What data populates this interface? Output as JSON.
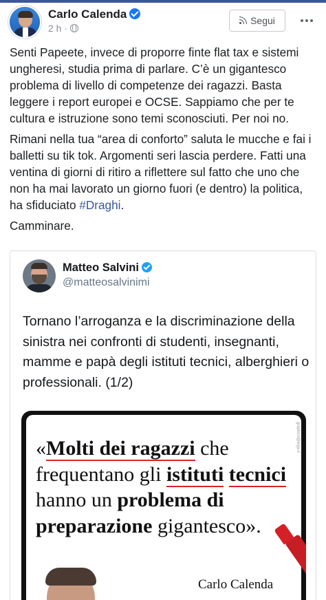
{
  "post": {
    "author_name": "Carlo Calenda",
    "time": "2 h ·",
    "follow_label": "Segui",
    "paragraph1": "Senti Papeete, invece di proporre finte flat tax e sistemi ungheresi, studia prima di parlare. C’è un gigantesco problema di livello di competenze dei ragazzi. Basta leggere i report europei e OCSE. Sappiamo che per te cultura e istruzione sono temi sconosciuti. Per noi no.",
    "paragraph2_before_tag": "Rimani nella tua “area di conforto” saluta le mucche e fai i balletti su tik tok. Argomenti seri lascia perdere. Fatti una ventina di giorni di ritiro a riflettere sul fatto che uno che non ha mai lavorato un giorno fuori (e dentro) la politica, ha sfiduciato ",
    "hashtag": "#Draghi",
    "paragraph2_after_tag": ".",
    "paragraph3": "Camminare."
  },
  "quoted_tweet": {
    "author_name": "Matteo Salvini",
    "handle": "@matteosalvinimi",
    "text": "Tornano l’arroganza e la discriminazione della sinistra nei confronti di studenti, insegnanti, mamme e papà degli istituti tecnici, alberghieri o professionali. (1/2)",
    "image": {
      "quote_open": "«",
      "q1": "Molti dei ragazzi",
      "q2": " che frequentano gli ",
      "q3": "istituti",
      "q4": "tecnici",
      "q5": " hanno un ",
      "q6": "problema di preparazione",
      "q7": " gigantesco",
      "quote_close": "».",
      "author": "Carlo Calenda",
      "side_credit": "graphics@lega.it"
    }
  },
  "colors": {
    "facebook_blue": "#1877f2",
    "hashtag": "#385898",
    "underline_red": "#d8232a"
  },
  "icons": [
    "verified-badge-icon",
    "globe-icon",
    "rss-icon",
    "more-options-icon",
    "twitter-verified-icon",
    "red-marker-icon"
  ]
}
